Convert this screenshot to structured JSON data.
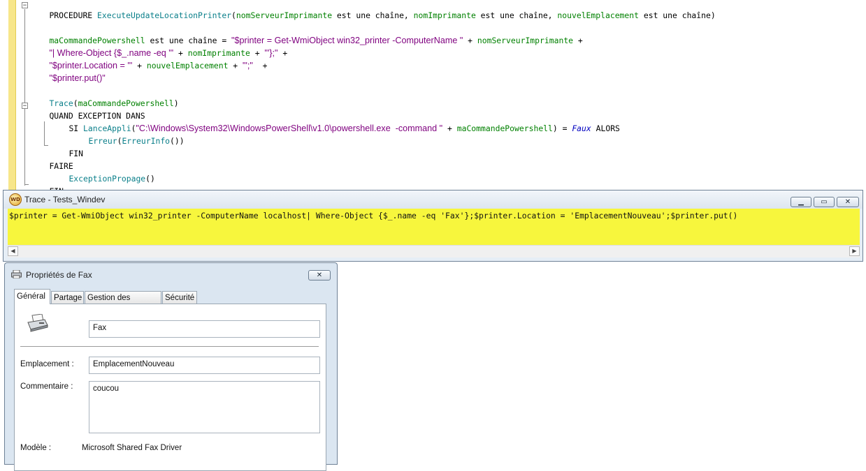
{
  "editor": {
    "lines": [
      [
        "PROCEDURE ",
        "ExecuteUpdateLocationPrinter",
        "(",
        "nomServeurImprimante",
        " est une chaîne, ",
        "nomImprimante",
        " est une chaîne, ",
        "nouvelEmplacement",
        " est une chaîne)"
      ],
      [
        "maCommandePowershell",
        " est une chaîne = ",
        "\"$printer = Get-WmiObject win32_printer -ComputerName \"",
        " + ",
        "nomServeurImprimante",
        " +"
      ],
      [
        "\"| Where-Object {$_.name -eq '\"",
        " + ",
        "nomImprimante",
        " + ",
        "\"'};\"",
        " +"
      ],
      [
        "\"$printer.Location = '\"",
        " + ",
        "nouvelEmplacement",
        " + ",
        "\"';\"",
        "  +"
      ],
      [
        "\"$printer.put()\""
      ],
      [
        "Trace",
        "(",
        "maCommandePowershell",
        ")"
      ],
      [
        "QUAND EXCEPTION DANS"
      ],
      [
        "SI ",
        "LanceAppli",
        "(",
        "\"C:\\Windows\\System32\\WindowsPowerShell\\v1.0\\powershell.exe  -command \"",
        " + ",
        "maCommandePowershell",
        ") = ",
        "Faux",
        " ALORS"
      ],
      [
        "Erreur",
        "(",
        "ErreurInfo",
        "())"
      ],
      [
        "FIN"
      ],
      [
        "FAIRE"
      ],
      [
        "ExceptionPropage",
        "()"
      ],
      [
        "FIN"
      ]
    ]
  },
  "trace": {
    "title": "Trace - Tests_Windev",
    "icon": "windev-icon",
    "content": "$printer = Get-WmiObject win32_printer -ComputerName localhost| Where-Object {$_.name -eq 'Fax'};$printer.Location = 'EmplacementNouveau';$printer.put()",
    "bg_color": "#f7f63d",
    "buttons": [
      "minimize",
      "maximize",
      "close"
    ]
  },
  "props": {
    "title": "Propriétés de Fax",
    "tabs": [
      "Général",
      "Partage",
      "Gestion des couleurs",
      "Sécurité"
    ],
    "active_tab": "Général",
    "printer_name": "Fax",
    "location_label": "Emplacement :",
    "location_value": "EmplacementNouveau",
    "comment_label": "Commentaire :",
    "comment_value": "coucou",
    "model_label": "Modèle :",
    "model_value": "Microsoft Shared Fax Driver"
  }
}
